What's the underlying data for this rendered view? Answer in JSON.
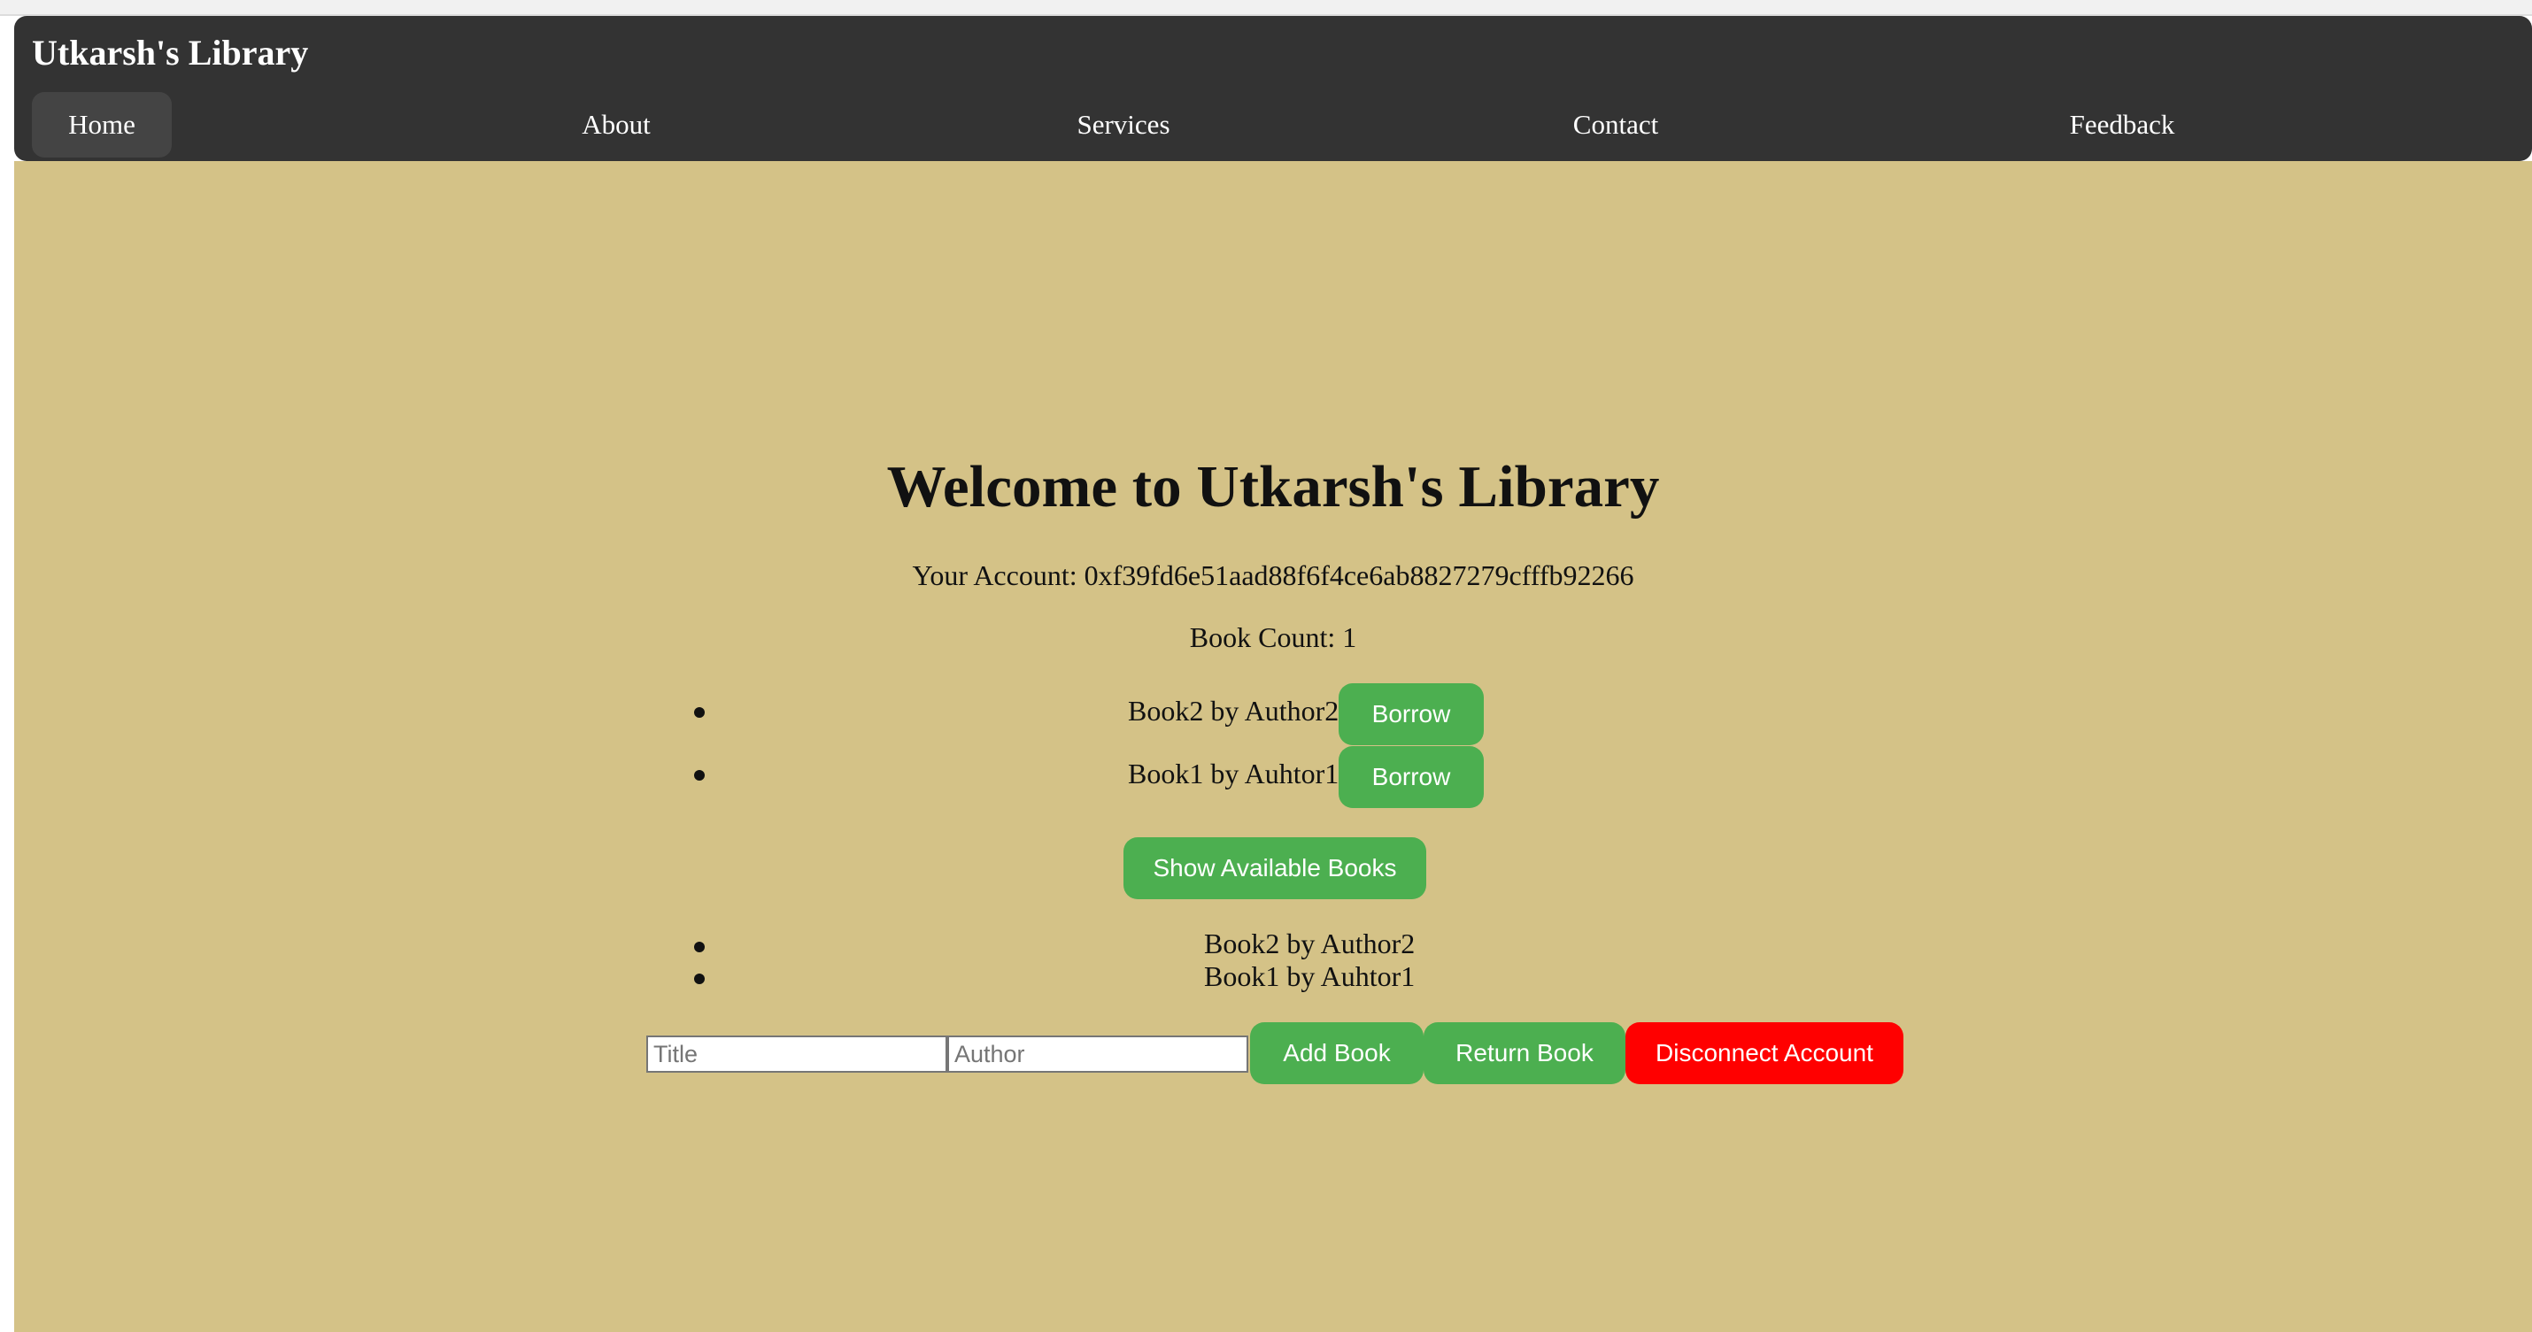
{
  "header": {
    "title": "Utkarsh's Library",
    "nav": [
      {
        "label": "Home",
        "active": true
      },
      {
        "label": "About",
        "active": false
      },
      {
        "label": "Services",
        "active": false
      },
      {
        "label": "Contact",
        "active": false
      },
      {
        "label": "Feedback",
        "active": false
      }
    ]
  },
  "main": {
    "heading": "Welcome to Utkarsh's Library",
    "account_text": "Your Account: 0xf39fd6e51aad88f6f4ce6ab8827279cfffb92266",
    "book_count_text": "Book Count: 1",
    "borrow_list": [
      {
        "text": "Book2 by Author2",
        "button": "Borrow"
      },
      {
        "text": "Book1 by Auhtor1",
        "button": "Borrow"
      }
    ],
    "show_button": "Show Available Books",
    "available_list": [
      {
        "text": "Book2 by Author2"
      },
      {
        "text": "Book1 by Auhtor1"
      }
    ],
    "form": {
      "title_placeholder": "Title",
      "author_placeholder": "Author",
      "add_label": "Add Book",
      "return_label": "Return Book",
      "disconnect_label": "Disconnect Account"
    }
  },
  "colors": {
    "navbar": "#333333",
    "background": "#d4c287",
    "accent_green": "#4caf50",
    "danger_red": "#ff0000"
  }
}
